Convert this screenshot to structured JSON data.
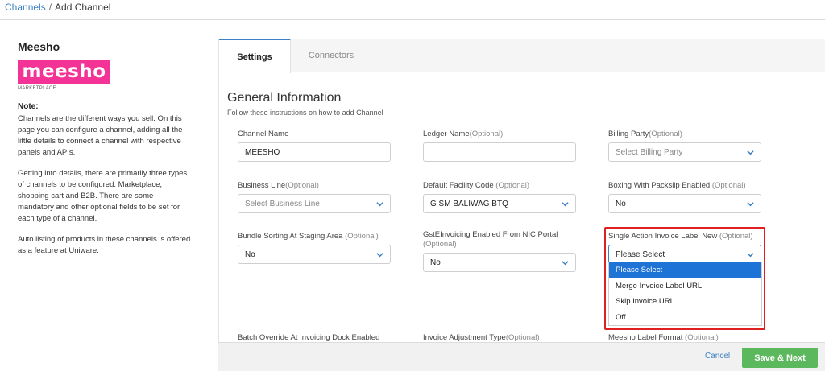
{
  "breadcrumb": {
    "link": "Channels",
    "separator": "/",
    "current": "Add Channel"
  },
  "channel": {
    "name": "Meesho",
    "logo_text": "meesho",
    "logo_sub": "MARKETPLACE",
    "logo_color": "#f43397"
  },
  "note": {
    "title": "Note:",
    "p1": "Channels are the different ways you sell. On this page you can configure a channel, adding all the little details to connect a channel with respective panels and APIs.",
    "p2": "Getting into details, there are primarily three types of channels to be configured: Marketplace, shopping cart and B2B. There are some mandatory and other optional fields to be set for each type of a channel.",
    "p3": "Auto listing of products in these channels is offered as a feature at Uniware."
  },
  "tabs": {
    "settings": "Settings",
    "connectors": "Connectors"
  },
  "section": {
    "title": "General Information",
    "subtitle": "Follow these instructions on how to add Channel"
  },
  "fields": {
    "channel_name": {
      "label": "Channel Name",
      "value": "MEESHO"
    },
    "ledger_name": {
      "label": "Ledger Name",
      "opt": "(Optional)",
      "value": ""
    },
    "billing_party": {
      "label": "Billing Party",
      "opt": "(Optional)",
      "placeholder": "Select Billing Party"
    },
    "business_line": {
      "label": "Business Line",
      "opt": "(Optional)",
      "placeholder": "Select Business Line"
    },
    "default_facility": {
      "label": "Default Facility Code ",
      "opt": "(Optional)",
      "value": "G SM BALIWAG BTQ"
    },
    "boxing_packslip": {
      "label": "Boxing With Packslip Enabled ",
      "opt": "(Optional)",
      "value": "No"
    },
    "bundle_sorting": {
      "label": "Bundle Sorting At Staging Area ",
      "opt": "(Optional)",
      "value": "No"
    },
    "gst_einvoicing": {
      "label": "GstEInvoicing Enabled From NIC Portal",
      "opt": "(Optional)",
      "value": "No"
    },
    "single_action": {
      "label": "Single Action Invoice Label New ",
      "opt": "(Optional)",
      "value": "Please Select"
    },
    "batch_override": {
      "label": "Batch Override At Invoicing Dock Enabled"
    },
    "invoice_adjustment": {
      "label": "Invoice Adjustment Type",
      "opt": "(Optional)"
    },
    "meesho_label": {
      "label": "Meesho Label Format ",
      "opt": "(Optional)"
    }
  },
  "dropdown_options": [
    "Please Select",
    "Merge Invoice Label URL",
    "Skip Invoice URL",
    "Off"
  ],
  "footer": {
    "cancel": "Cancel",
    "save": "Save & Next"
  },
  "colors": {
    "accent": "#3b7fc4",
    "save": "#5cb85c",
    "highlight": "#e02020",
    "selected": "#1e73d6"
  }
}
